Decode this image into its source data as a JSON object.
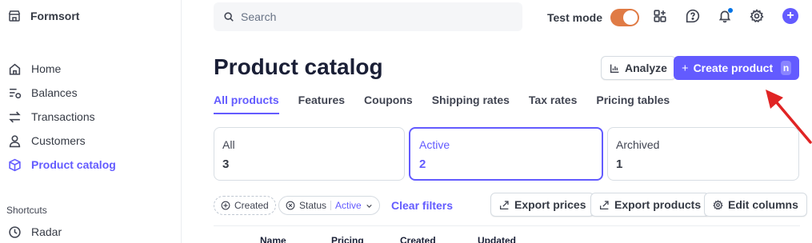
{
  "sidebar": {
    "brand": "Formsort",
    "items": [
      {
        "label": "Home",
        "icon": "home-icon"
      },
      {
        "label": "Balances",
        "icon": "balances-icon"
      },
      {
        "label": "Transactions",
        "icon": "transactions-icon"
      },
      {
        "label": "Customers",
        "icon": "customers-icon"
      },
      {
        "label": "Product catalog",
        "icon": "product-catalog-icon",
        "active": true
      }
    ],
    "shortcuts_label": "Shortcuts",
    "shortcuts": [
      {
        "label": "Radar",
        "icon": "clock-icon"
      }
    ]
  },
  "topbar": {
    "search_placeholder": "Search",
    "test_mode_label": "Test mode",
    "test_mode_on": true
  },
  "header": {
    "title": "Product catalog",
    "analyze_label": "Analyze",
    "create_label": "Create product",
    "create_shortcut": "n"
  },
  "tabs": [
    {
      "label": "All products",
      "active": true
    },
    {
      "label": "Features"
    },
    {
      "label": "Coupons"
    },
    {
      "label": "Shipping rates"
    },
    {
      "label": "Tax rates"
    },
    {
      "label": "Pricing tables"
    }
  ],
  "status_cards": [
    {
      "label": "All",
      "count": "3"
    },
    {
      "label": "Active",
      "count": "2",
      "active": true
    },
    {
      "label": "Archived",
      "count": "1"
    }
  ],
  "filters": {
    "created_label": "Created",
    "status_label": "Status",
    "status_value": "Active",
    "clear_label": "Clear filters"
  },
  "actions": {
    "export_prices": "Export prices",
    "export_products": "Export products",
    "edit_columns": "Edit columns"
  },
  "table": {
    "columns": [
      "Name",
      "Pricing",
      "Created",
      "Updated"
    ]
  },
  "colors": {
    "accent": "#635bff",
    "toggle": "#e07b45",
    "annotation_arrow": "#e02424"
  }
}
